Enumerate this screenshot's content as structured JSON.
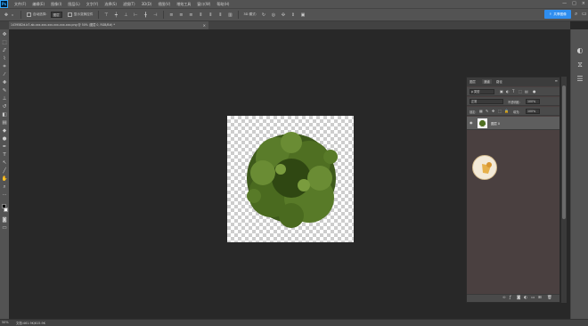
{
  "app": {
    "logo": "Ps"
  },
  "menu": [
    "文件(F)",
    "编辑(E)",
    "图像(I)",
    "图层(L)",
    "文字(Y)",
    "选择(S)",
    "滤镜(T)",
    "3D(D)",
    "视图(V)",
    "增效工具",
    "窗口(W)",
    "帮助(H)"
  ],
  "window_controls": {
    "min": "—",
    "max": "□",
    "close": "×"
  },
  "options": {
    "tool_icon": "move-tool-icon",
    "auto_select_label": "自动选择:",
    "auto_select_value": "图层",
    "show_transform_label": "显示变换控件",
    "mode_3d_label": "3D 模式:"
  },
  "share": {
    "label": "共享图像"
  },
  "document_tab": {
    "title": "1439582d-b7-ab-xxx-xxx-xxx-xxx-xxx-xxx.png @ 50% (图层 0, RGB/8#) *",
    "close": "×"
  },
  "layers_panel": {
    "tabs": [
      "图层",
      "通道",
      "路径"
    ],
    "active_tab": 0,
    "menu": "≡",
    "filter_label": "ρ 类型",
    "blend_mode": "正常",
    "opacity_label": "不透明度:",
    "opacity": "100%",
    "lock_label": "锁定:",
    "fill_label": "填充:",
    "fill": "100%",
    "layers": [
      {
        "name": "图层 0",
        "visible": true
      }
    ],
    "footer_icons": [
      "link-icon",
      "fx-icon",
      "mask-icon",
      "adjustment-icon",
      "folder-icon",
      "new-layer-icon",
      "trash-icon"
    ]
  },
  "status": {
    "zoom": "50%",
    "info": "文档:461.9K/615.9K"
  },
  "colors": {
    "accent": "#2f8ef0",
    "foliage": "#4f6f22"
  }
}
